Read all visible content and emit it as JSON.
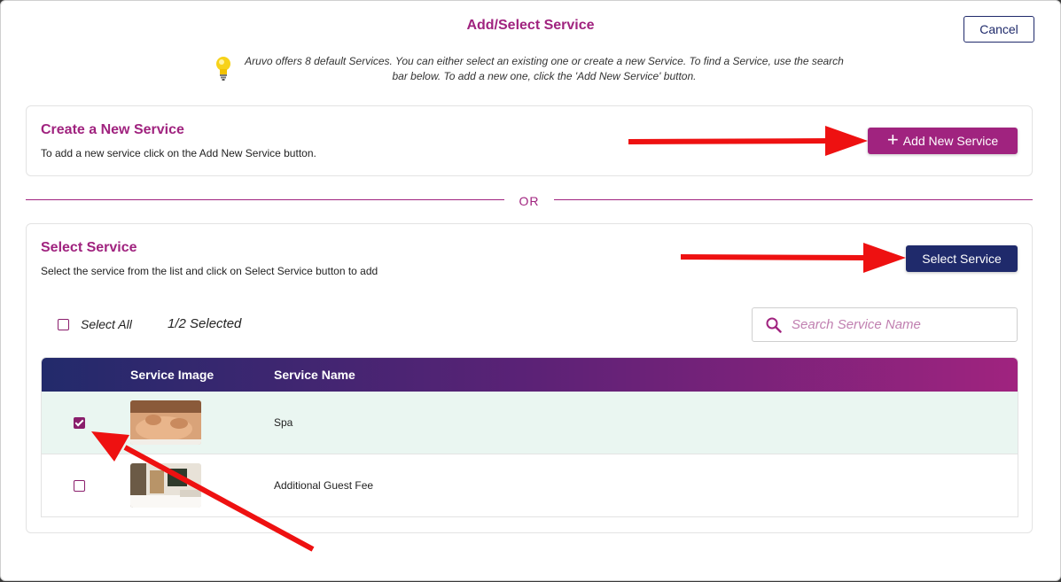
{
  "modal": {
    "title": "Add/Select Service",
    "cancel_label": "Cancel",
    "info_text": "Aruvo offers 8 default Services. You can either select an existing one or create a new Service. To find a Service, use the search bar below. To add a new one, click the 'Add New Service' button.",
    "info_icon": "lightbulb-icon"
  },
  "create_section": {
    "title": "Create a New Service",
    "description": "To add a new service click on the Add New Service button.",
    "button_label": "Add New Service",
    "button_icon": "plus-icon"
  },
  "divider": {
    "label": "OR"
  },
  "select_section": {
    "title": "Select Service",
    "description": "Select the service from the list and click on Select Service button to add",
    "button_label": "Select Service",
    "select_all_label": "Select All",
    "select_all_checked": false,
    "selected_count": "1/2 Selected",
    "search": {
      "placeholder": "Search Service Name",
      "value": "",
      "icon": "search-icon"
    }
  },
  "table": {
    "columns": [
      "",
      "Service Image",
      "Service Name"
    ],
    "rows": [
      {
        "name": "Spa",
        "checked": true,
        "image": "spa-massage-thumbnail"
      },
      {
        "name": "Additional Guest Fee",
        "checked": false,
        "image": "guest-room-thumbnail"
      }
    ]
  },
  "colors": {
    "accent": "#a0237f",
    "navy": "#1f2a6b",
    "selected_row": "#eaf6f1",
    "annotation_arrow": "#ee1111"
  }
}
